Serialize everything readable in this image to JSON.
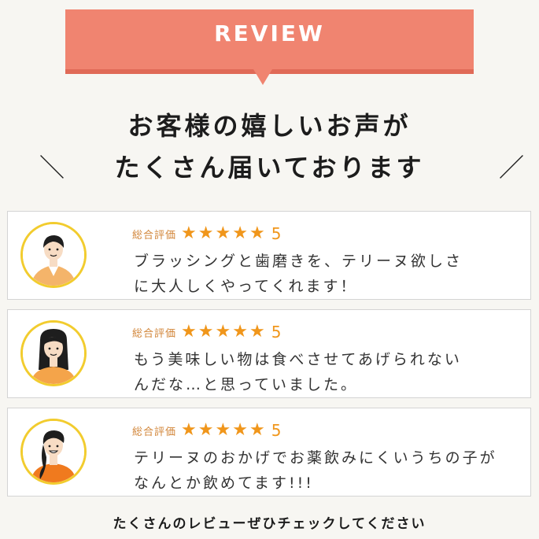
{
  "banner": {
    "label": "REVIEW"
  },
  "headline": {
    "line1": "お客様の嬉しいお声が",
    "line2": "たくさん届いております",
    "slash_left": "＼",
    "slash_right": "／"
  },
  "reviews": [
    {
      "rating_label": "総合評価",
      "stars": 5,
      "rating_value": "5",
      "line1": "ブラッシングと歯磨きを、テリーヌ欲しさ",
      "line2": "に大人しくやってくれます！"
    },
    {
      "rating_label": "総合評価",
      "stars": 5,
      "rating_value": "5",
      "line1": "もう美味しい物は食べさせてあげられない",
      "line2": "んだな…と思っていました。"
    },
    {
      "rating_label": "総合評価",
      "stars": 5,
      "rating_value": "5",
      "line1": "テリーヌのおかげでお薬飲みにくいうちの子が",
      "line2": "なんとか飲めてます!!!"
    }
  ],
  "footer": {
    "text": "たくさんのレビューぜひチェックしてください"
  },
  "colors": {
    "banner": "#f08470",
    "star": "#f0961b",
    "avatar_ring": "#f2cc2e",
    "rating_label": "#d2863a"
  }
}
